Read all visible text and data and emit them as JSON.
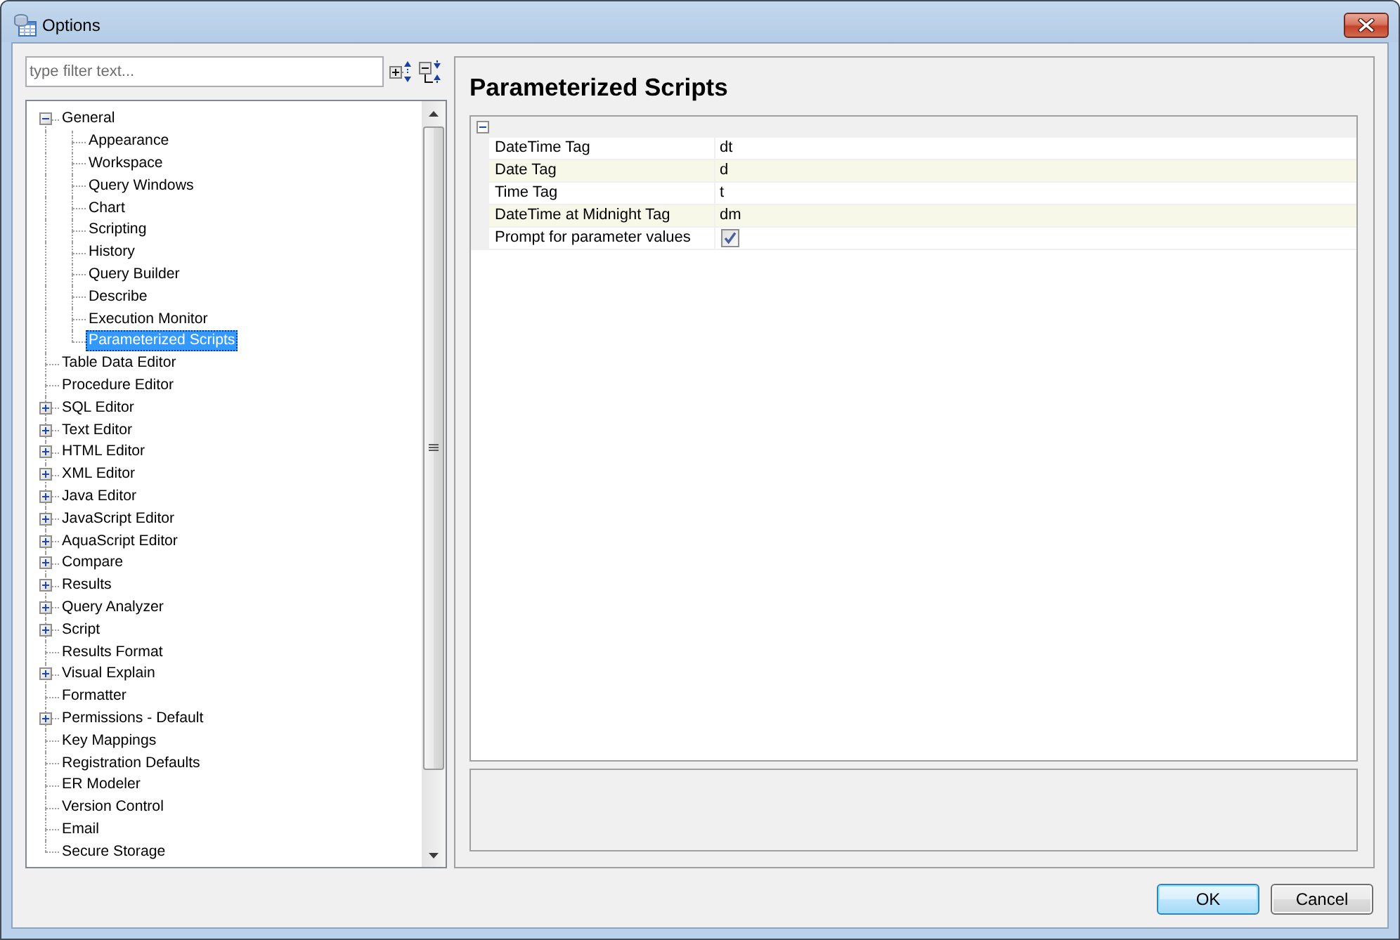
{
  "window": {
    "title": "Options"
  },
  "filter": {
    "placeholder": "type filter text..."
  },
  "tree": {
    "items": [
      {
        "label": "General",
        "kind": "group",
        "expanded": true,
        "selected": false,
        "children": [
          {
            "label": "Appearance",
            "kind": "leaf",
            "selected": false
          },
          {
            "label": "Workspace",
            "kind": "leaf",
            "selected": false
          },
          {
            "label": "Query Windows",
            "kind": "leaf",
            "selected": false
          },
          {
            "label": "Chart",
            "kind": "leaf",
            "selected": false
          },
          {
            "label": "Scripting",
            "kind": "leaf",
            "selected": false
          },
          {
            "label": "History",
            "kind": "leaf",
            "selected": false
          },
          {
            "label": "Query Builder",
            "kind": "leaf",
            "selected": false
          },
          {
            "label": "Describe",
            "kind": "leaf",
            "selected": false
          },
          {
            "label": "Execution Monitor",
            "kind": "leaf",
            "selected": false
          },
          {
            "label": "Parameterized Scripts",
            "kind": "leaf",
            "selected": true
          }
        ]
      },
      {
        "label": "Table Data Editor",
        "kind": "leaf",
        "selected": false
      },
      {
        "label": "Procedure Editor",
        "kind": "leaf",
        "selected": false
      },
      {
        "label": "SQL Editor",
        "kind": "group",
        "expanded": false,
        "selected": false
      },
      {
        "label": "Text Editor",
        "kind": "group",
        "expanded": false,
        "selected": false
      },
      {
        "label": "HTML Editor",
        "kind": "group",
        "expanded": false,
        "selected": false
      },
      {
        "label": "XML Editor",
        "kind": "group",
        "expanded": false,
        "selected": false
      },
      {
        "label": "Java Editor",
        "kind": "group",
        "expanded": false,
        "selected": false
      },
      {
        "label": "JavaScript Editor",
        "kind": "group",
        "expanded": false,
        "selected": false
      },
      {
        "label": "AquaScript Editor",
        "kind": "group",
        "expanded": false,
        "selected": false
      },
      {
        "label": "Compare",
        "kind": "group",
        "expanded": false,
        "selected": false
      },
      {
        "label": "Results",
        "kind": "group",
        "expanded": false,
        "selected": false
      },
      {
        "label": "Query Analyzer",
        "kind": "group",
        "expanded": false,
        "selected": false
      },
      {
        "label": "Script",
        "kind": "group",
        "expanded": false,
        "selected": false
      },
      {
        "label": "Results Format",
        "kind": "leaf",
        "selected": false
      },
      {
        "label": "Visual Explain",
        "kind": "group",
        "expanded": false,
        "selected": false
      },
      {
        "label": "Formatter",
        "kind": "leaf",
        "selected": false
      },
      {
        "label": "Permissions - Default",
        "kind": "group",
        "expanded": false,
        "selected": false
      },
      {
        "label": "Key Mappings",
        "kind": "leaf",
        "selected": false
      },
      {
        "label": "Registration Defaults",
        "kind": "leaf",
        "selected": false
      },
      {
        "label": "ER Modeler",
        "kind": "leaf",
        "selected": false
      },
      {
        "label": "Version Control",
        "kind": "leaf",
        "selected": false
      },
      {
        "label": "Email",
        "kind": "leaf",
        "selected": false
      },
      {
        "label": "Secure Storage",
        "kind": "leaf",
        "selected": false
      }
    ]
  },
  "page": {
    "title": "Parameterized Scripts"
  },
  "property_grid": {
    "expanded": true,
    "rows": [
      {
        "kind": "text",
        "name": "DateTime Tag",
        "value": "dt"
      },
      {
        "kind": "text",
        "name": "Date Tag",
        "value": "d"
      },
      {
        "kind": "text",
        "name": "Time Tag",
        "value": "t"
      },
      {
        "kind": "text",
        "name": "DateTime at Midnight Tag",
        "value": "dm"
      },
      {
        "kind": "checkbox",
        "name": "Prompt for parameter values",
        "checked": true
      }
    ]
  },
  "buttons": [
    {
      "label": "OK",
      "default": true
    },
    {
      "label": "Cancel",
      "default": false
    }
  ]
}
